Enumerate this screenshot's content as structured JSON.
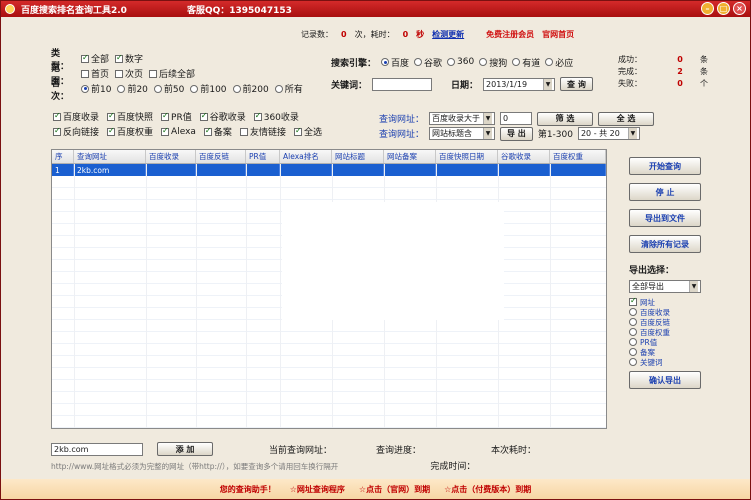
{
  "window": {
    "title": "百度搜索排名查询工具2.0",
    "qq_label": "客服QQ：1395047153",
    "controls": {
      "minimize": "–",
      "maximize": "□",
      "close": "×"
    }
  },
  "status": {
    "records_label": "记录数：",
    "records_value": "0",
    "count_label": "次，耗时：",
    "time_value": "0",
    "time_unit": "秒",
    "check_link": "检测更新",
    "register_link": "免费注册会员",
    "official_link": "官网首页"
  },
  "options": {
    "type_label": "类型：",
    "type_items": [
      {
        "label": "全部",
        "checked": true
      },
      {
        "label": "数字",
        "checked": true
      }
    ],
    "scope_label": "范围：",
    "scope_items": [
      {
        "label": "首页",
        "checked": false
      },
      {
        "label": "次页",
        "checked": false
      },
      {
        "label": "后续全部",
        "checked": false
      }
    ],
    "depth_label": "名次：",
    "depth_items": [
      {
        "label": "前10",
        "selected": true
      },
      {
        "label": "前20",
        "selected": false
      },
      {
        "label": "前50",
        "selected": false
      },
      {
        "label": "前100",
        "selected": false
      },
      {
        "label": "前200",
        "selected": false
      },
      {
        "label": "所有",
        "selected": false
      }
    ]
  },
  "engine": {
    "label": "搜索引擎：",
    "options": [
      "百度",
      "谷歌",
      "360",
      "搜狗",
      "有道",
      "必应"
    ],
    "selected_index": 0,
    "keyword_label": "关键词：",
    "keyword_value": "",
    "date_label": "日期：",
    "date_value": "2013/1/19",
    "query_button": "查 询"
  },
  "counts": [
    {
      "label": "成功：",
      "value": "0",
      "unit": "条"
    },
    {
      "label": "完成：",
      "value": "2",
      "unit": "条"
    },
    {
      "label": "失败：",
      "value": "0",
      "unit": "个"
    }
  ],
  "fields": {
    "row1": [
      {
        "label": "百度收录",
        "checked": true
      },
      {
        "label": "百度快照",
        "checked": true
      },
      {
        "label": "PR值",
        "checked": true
      },
      {
        "label": "谷歌收录",
        "checked": true
      },
      {
        "label": "360收录",
        "checked": true
      }
    ],
    "row2": [
      {
        "label": "反向链接",
        "checked": true
      },
      {
        "label": "百度权重",
        "checked": true
      },
      {
        "label": "Alexa",
        "checked": true
      },
      {
        "label": "备案",
        "checked": true
      },
      {
        "label": "友情链接",
        "checked": false
      },
      {
        "label": "全选",
        "checked": true
      }
    ]
  },
  "query": {
    "row1_label": "查询网址：",
    "row1_select": "百度收录大于",
    "row1_value": "0",
    "row1_button": "筛 选",
    "row1_button2": "全 选",
    "row2_label": "查询网址：",
    "row2_select": "网站标题含",
    "row2_button": "导 出",
    "row2_page": "第1-300",
    "row2_page_select": "20 - 共 20"
  },
  "table": {
    "columns": [
      "序",
      "查询网址",
      "百度收录",
      "百度反链",
      "PR值",
      "Alexa排名",
      "网站标题",
      "网站备案",
      "百度快照日期",
      "谷歌收录",
      "百度权重"
    ],
    "rows": [
      [
        "1",
        "2kb.com",
        "",
        "",
        "",
        "",
        "",
        "",
        "",
        "",
        ""
      ]
    ]
  },
  "side": {
    "buttons": [
      "开始查询",
      "停 止",
      "导出到文件",
      "清除所有记录"
    ],
    "export_label": "导出选择：",
    "export_select": "全部导出",
    "export_options": [
      {
        "label": "网址",
        "checked": true
      },
      {
        "label": "百度收录",
        "checked": false
      },
      {
        "label": "百度反链",
        "checked": false
      },
      {
        "label": "百度权重",
        "checked": false
      },
      {
        "label": "PR值",
        "checked": false
      },
      {
        "label": "备案",
        "checked": false
      },
      {
        "label": "关键词",
        "checked": false
      }
    ],
    "confirm_button": "确认导出"
  },
  "bottom": {
    "input_value": "2kb.com",
    "add_button": "添 加",
    "current_label": "当前查询网址：",
    "progress_label": "查询进度：",
    "elapsed_label": "本次耗时：",
    "finish_label": "完成时间：",
    "hint": "http://www.网址格式必须为完整的网址（带http://），如要查询多个请用回车换行隔开"
  },
  "footer": {
    "items": [
      "您的查询助手！",
      "☆网址查询程序",
      "☆点击（官网）到期",
      "☆点击（付费版本）到期"
    ]
  },
  "colors": {
    "accent": "#c00000",
    "link": "#1a3fb0",
    "selection": "#1a5fd0"
  }
}
